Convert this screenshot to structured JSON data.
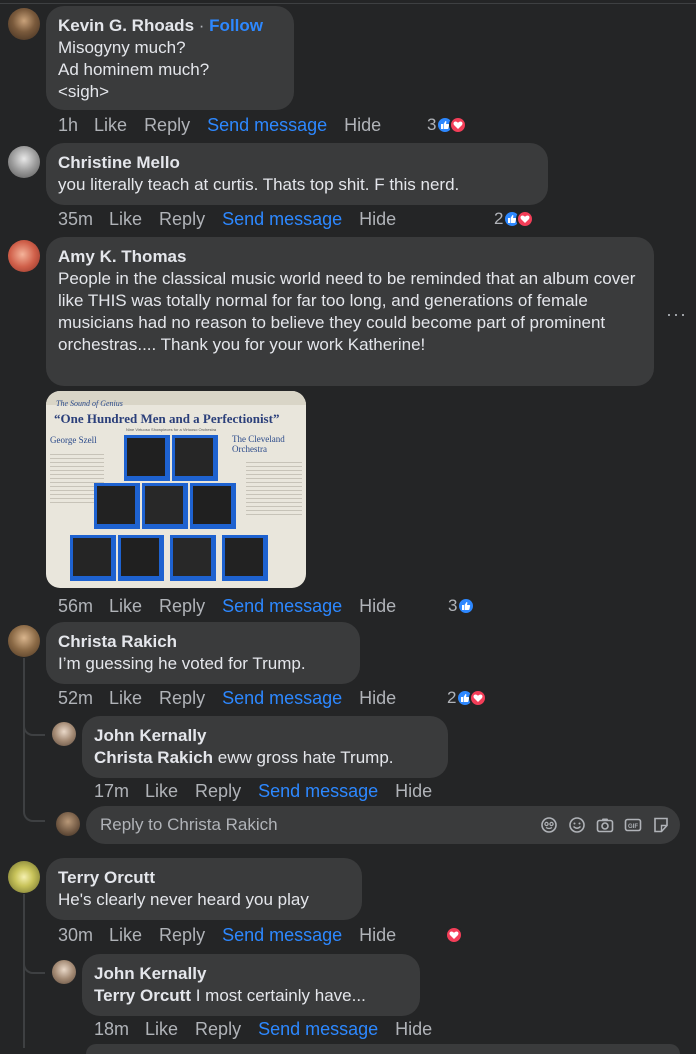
{
  "comments": [
    {
      "author": "Kevin G. Rhoads",
      "follow": "Follow",
      "separator": "·",
      "text": "Misogyny much?\nAd hominem much?\n<sigh>",
      "time": "1h",
      "reaction_count": "3",
      "reactions": [
        "like-icon",
        "love-icon"
      ]
    },
    {
      "author": "Christine Mello",
      "text": "you literally teach at curtis. Thats top shit. F this nerd.",
      "time": "35m",
      "reaction_count": "2",
      "reactions": [
        "like-icon",
        "love-icon"
      ]
    },
    {
      "author": "Amy K. Thomas",
      "text": "People in the classical music world need to be reminded that an album cover like THIS was totally normal for far too long, and generations of female musicians had no reason to believe they could become part of prominent orchestras.... Thank you for your work Katherine!",
      "time": "56m",
      "reaction_count": "3",
      "reactions": [
        "like-icon"
      ],
      "more": "···",
      "album": {
        "series": "The Sound of Genius",
        "title": "“One Hundred Men and a Perfectionist”",
        "subtitle": "Nine Virtuoso Showpieces for a Virtuoso Orchestra",
        "conductor": "George Szell",
        "orchestra": "The Cleveland Orchestra"
      }
    },
    {
      "author": "Christa Rakich",
      "text": "I’m guessing he voted for Trump.",
      "time": "52m",
      "reaction_count": "2",
      "reactions": [
        "like-icon",
        "love-icon"
      ]
    },
    {
      "author": "John Kernally",
      "tag": "Christa Rakich",
      "text": " eww gross hate Trump.",
      "time": "17m"
    },
    {
      "author": "Terry Orcutt",
      "text": "He's clearly never heard you play",
      "time": "30m",
      "reactions": [
        "love-icon"
      ]
    },
    {
      "author": "John Kernally",
      "tag": "Terry Orcutt",
      "text": " I most certainly have...",
      "time": "18m"
    }
  ],
  "actions": {
    "like": "Like",
    "reply": "Reply",
    "send": "Send message",
    "hide": "Hide"
  },
  "reply_box": {
    "placeholder": "Reply to Christa Rakich",
    "icons": [
      "sticker-avatar-icon",
      "emoji-icon",
      "camera-icon",
      "gif-icon",
      "sticker-icon"
    ]
  },
  "colors": {
    "background": "#242526",
    "bubble": "#3a3b3c",
    "accent": "#2d88ff",
    "love": "#f33e58",
    "muted": "#b0b3b8"
  }
}
